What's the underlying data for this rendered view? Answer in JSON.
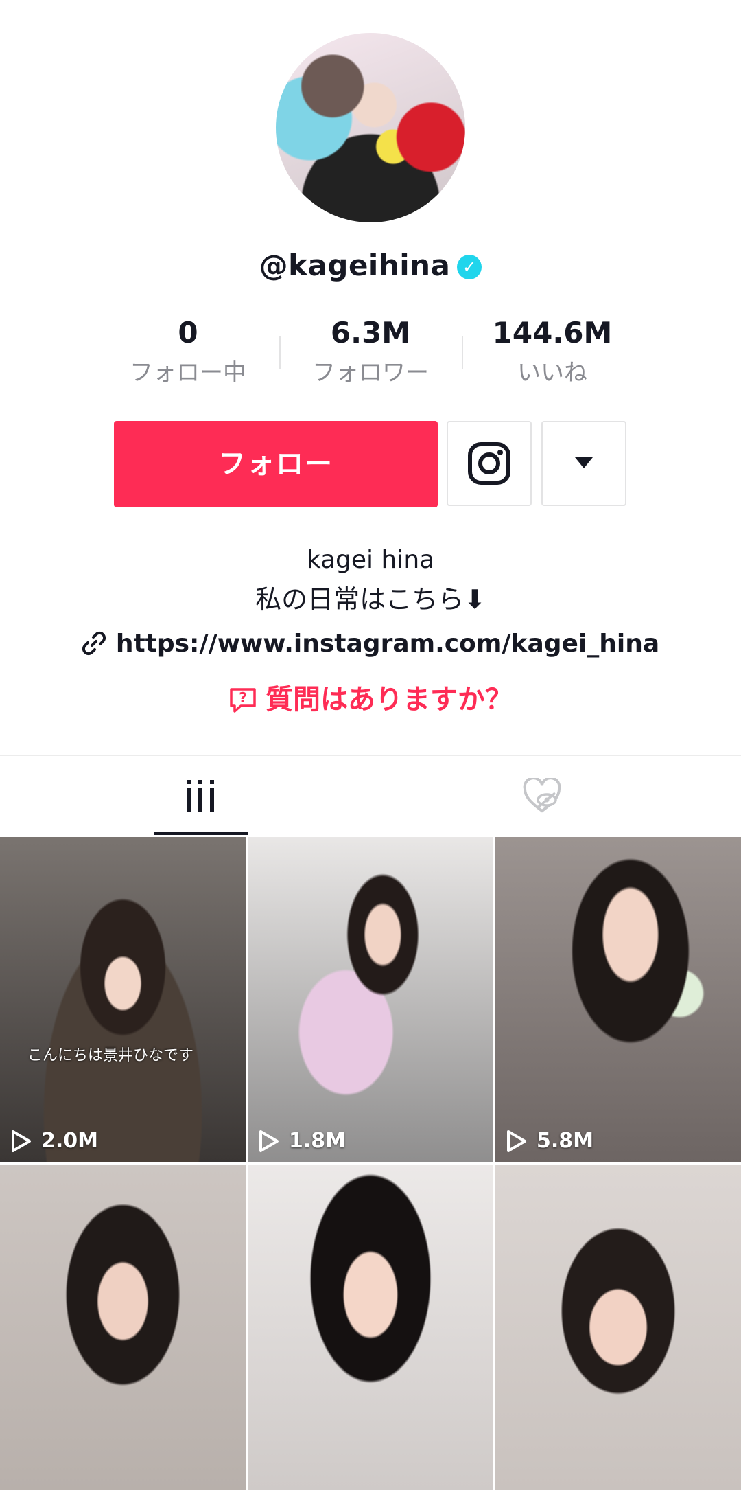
{
  "profile": {
    "username": "@kageihina",
    "display_name": "kagei hina",
    "bio": "私の日常はこちら⬇",
    "link": "https://www.instagram.com/kagei_hina",
    "qa_label": "質問はありますか？"
  },
  "stats": [
    {
      "value": "0",
      "label": "フォロー中"
    },
    {
      "value": "6.3M",
      "label": "フォロワー"
    },
    {
      "value": "144.6M",
      "label": "いいね"
    }
  ],
  "actions": {
    "follow_label": "フォロー"
  },
  "videos": [
    {
      "views": "2.0M",
      "caption": "こんにちは景井ひなです"
    },
    {
      "views": "1.8M"
    },
    {
      "views": "5.8M"
    },
    {
      "views": ""
    },
    {
      "views": ""
    },
    {
      "views": ""
    }
  ],
  "colors": {
    "accent": "#fe2c55",
    "verified": "#20d5ec",
    "text": "#161823",
    "muted": "#8a8b91"
  },
  "icons": {
    "verified": "verified-check-icon",
    "instagram": "instagram-icon",
    "dropdown": "triangle-down-icon",
    "link": "link-icon",
    "qa": "question-bubble-icon",
    "videos_tab": "grid-bars-icon",
    "liked_tab": "hidden-heart-icon",
    "play": "play-icon"
  }
}
